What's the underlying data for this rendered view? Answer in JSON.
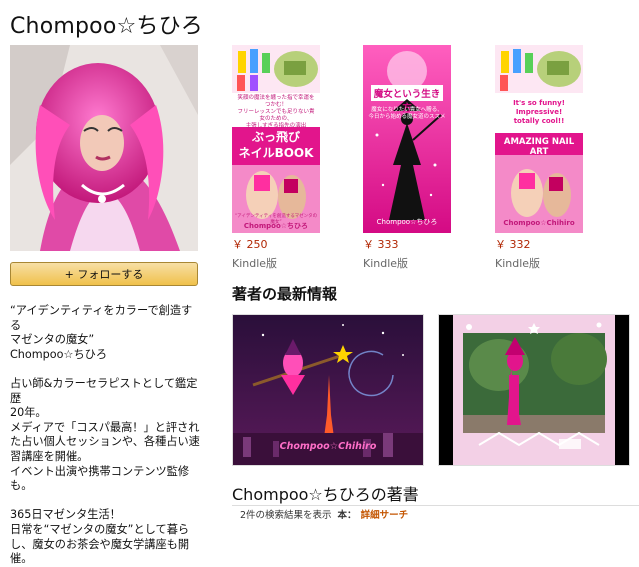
{
  "author": {
    "name": "Chompoo☆ちひろ",
    "follow_label": "+ フォローする",
    "bio": "“アイデンティティをカラーで創造する\nマゼンタの魔女”\nChompoo☆ちひろ\n\n占い師&カラーセラピストとして鑑定歴\n20年。\nメディアで「コスパ最高！」と評され\nた占い個人セッションや、各種占い速\n習講座を開催。\nイベント出演や携帯コンテンツ監修\nも。\n\n365日マゼンタ生活！\n日常を“マゼンタの魔女”として暮ら\nし、魔女のお茶会や魔女学講座も開\n催。"
  },
  "books": [
    {
      "subtitle": "笑顔の魔法を纏った指で幸運をつかむ！\nフリーレッスンでも足りない貴女のための、\n主張しすぎる指先の演出",
      "title": "ぶっ飛び\nネイルBOOK",
      "bottom_caption": "“アイデンティティを創造するマゼンタの魔女”",
      "bottom_author": "Chompoo☆ちひろ",
      "price": "￥ 250",
      "format": "Kindle版"
    },
    {
      "title": "魔女という生き方",
      "subtitle": "魔女になりたい貴女へ贈る、\n今日から始める魔女道のススメ",
      "bottom_author": "Chompoo☆ちひろ",
      "price": "￥ 333",
      "format": "Kindle版"
    },
    {
      "subtitle": "It's so funny! Impressive!\ntotally cool!!",
      "title": "AMAZING NAIL ART",
      "bottom_author": "Chompoo☆Chihiro",
      "price": "￥ 332",
      "format": "Kindle版"
    }
  ],
  "news": {
    "title": "著者の最新情報",
    "card1_logo": "Chompoo☆Chihiro"
  },
  "books_section": {
    "title": "Chompoo☆ちひろの著書"
  },
  "results": {
    "count_text": "2件の検索結果を表示",
    "book_label": "本：",
    "link_text": "詳細サーチ"
  },
  "colors": {
    "magenta": "#e2158c",
    "price_red": "#b12704",
    "link_orange": "#c45500",
    "button_gold": "#f0c14b"
  }
}
